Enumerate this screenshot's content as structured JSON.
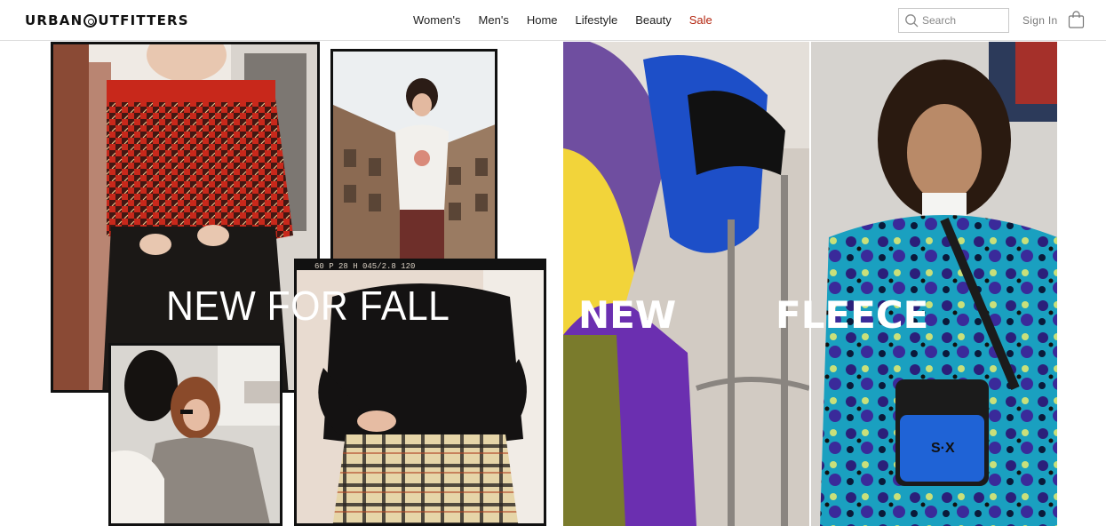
{
  "brand": {
    "logo_text_left": "URBAN",
    "logo_text_right": "UTFITTERS"
  },
  "nav": {
    "items": [
      {
        "label": "Women's"
      },
      {
        "label": "Men's"
      },
      {
        "label": "Home"
      },
      {
        "label": "Lifestyle"
      },
      {
        "label": "Beauty"
      },
      {
        "label": "Sale"
      }
    ]
  },
  "search": {
    "placeholder": "Search"
  },
  "account": {
    "signin_label": "Sign In"
  },
  "colors": {
    "sale": "#b3250f",
    "header_border": "#dcdcdc",
    "text": "#222222"
  },
  "hero": {
    "left_headline": "NEW FOR FALL",
    "right_headline_word1": "NEW",
    "right_headline_word2": "FLEECE"
  },
  "film_caption": "60 P 28     H     045/2.8 120"
}
